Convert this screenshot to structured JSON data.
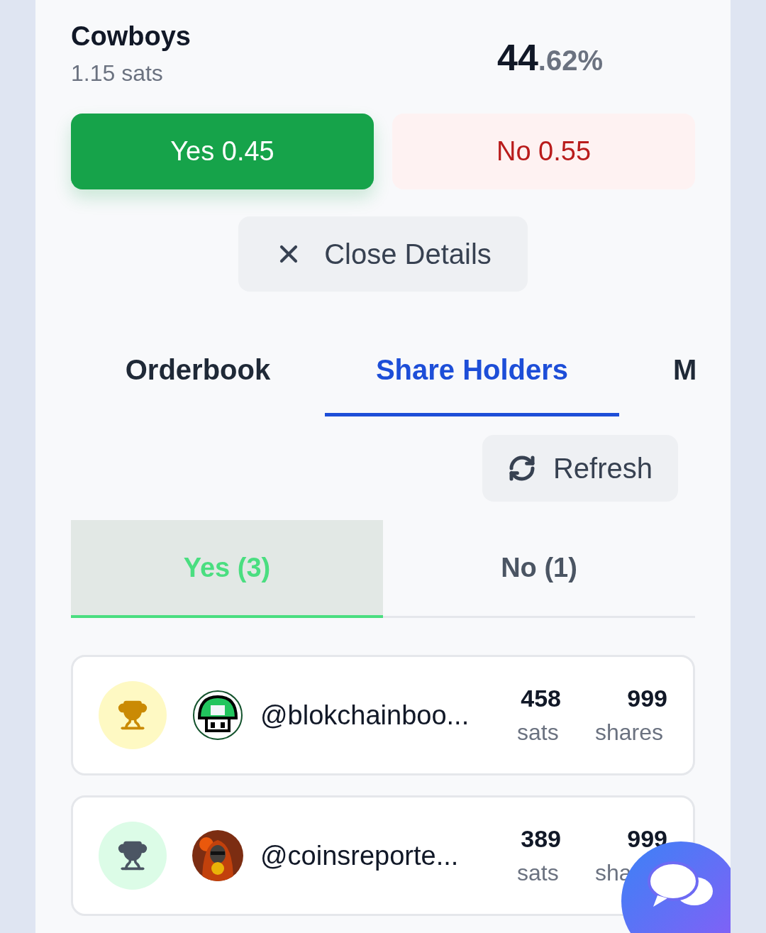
{
  "outcome": {
    "name": "Cowboys",
    "price": "1.15 sats",
    "percent_whole": "44",
    "percent_fraction": ".62%"
  },
  "trade_buttons": [
    {
      "kind": "yes",
      "label": "Yes 0.45"
    },
    {
      "kind": "no",
      "label": "No 0.55"
    }
  ],
  "close_button": {
    "label": "Close Details"
  },
  "tabs": [
    {
      "label": "Orderbook",
      "selected": false
    },
    {
      "label": "Share Holders",
      "selected": true
    },
    {
      "label": "M",
      "selected": false
    }
  ],
  "refresh_button": {
    "label": "Refresh"
  },
  "side_tabs": [
    {
      "label": "Yes (3)",
      "selected": true
    },
    {
      "label": "No (1)",
      "selected": false
    }
  ],
  "holders": [
    {
      "kind": "gold",
      "color": "#ca8a04",
      "username": "@blokchainboo...",
      "sats": "458",
      "sats_label": "sats",
      "shares": "999",
      "shares_label": "shares"
    },
    {
      "kind": "other",
      "color": "#4b5563",
      "username": "@coinsreporte...",
      "sats": "389",
      "sats_label": "sats",
      "shares": "999",
      "shares_label": "sha"
    }
  ]
}
